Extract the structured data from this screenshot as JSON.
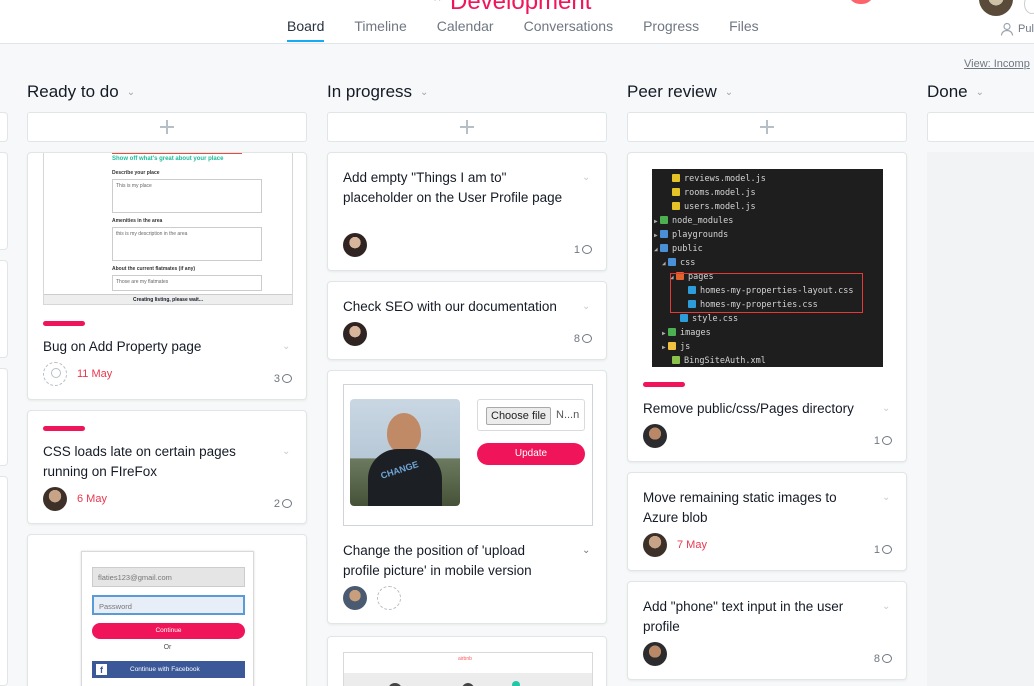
{
  "project": {
    "title": "Development"
  },
  "tabs": [
    "Board",
    "Timeline",
    "Calendar",
    "Conversations",
    "Progress",
    "Files"
  ],
  "header": {
    "public_label": "Pul",
    "view_filter": "View: Incomp"
  },
  "columns": [
    {
      "name": "Ready to do"
    },
    {
      "name": "In progress"
    },
    {
      "name": "Peer review"
    },
    {
      "name": "Done"
    }
  ],
  "cards": {
    "bug_add_property": {
      "title": "Bug on Add Property page",
      "due": "11 May",
      "comments": "3"
    },
    "css_late": {
      "title": "CSS loads late on certain pages running on FIreFox",
      "due": "6 May",
      "comments": "2"
    },
    "things_placeholder": {
      "title": "Add empty \"Things I am to\" placeholder on the User Profile page",
      "comments": "1"
    },
    "check_seo": {
      "title": "Check SEO with our documentation",
      "comments": "8"
    },
    "upload_position": {
      "title": "Change the position of 'upload profile picture' in mobile version"
    },
    "remove_css_dir": {
      "title": "Remove public/css/Pages directory",
      "comments": "1"
    },
    "static_images": {
      "title": "Move remaining static images to Azure blob",
      "due": "7 May",
      "comments": "1"
    },
    "phone_input": {
      "title": "Add \"phone\" text input in the user profile",
      "comments": "8"
    }
  },
  "screens": {
    "property_form": {
      "headline": "Show off what's great about your place",
      "describe_label": "Describe your place",
      "describe_value": "This is my place",
      "amenities_label": "Amenities in the area",
      "amenities_value": "this is my description in the area",
      "flatmates_label": "About the current flatmates (if any)",
      "flatmates_value": "Those are my flatmates",
      "status": "Creating listing, please wait..."
    },
    "file_tree": [
      {
        "name": "reviews.model.js",
        "icon": "js-icon"
      },
      {
        "name": "rooms.model.js",
        "icon": "js-icon"
      },
      {
        "name": "users.model.js",
        "icon": "js-icon"
      },
      {
        "name": "node_modules",
        "icon": "folder-icon"
      },
      {
        "name": "playgrounds",
        "icon": "folder-icon"
      },
      {
        "name": "public",
        "icon": "folder-icon"
      },
      {
        "name": "css",
        "icon": "folder-icon"
      },
      {
        "name": "pages",
        "icon": "folder-icon"
      },
      {
        "name": "homes-my-properties-layout.css",
        "icon": "css-icon"
      },
      {
        "name": "homes-my-properties.css",
        "icon": "css-icon"
      },
      {
        "name": "style.css",
        "icon": "css-icon"
      },
      {
        "name": "images",
        "icon": "folder-icon"
      },
      {
        "name": "js",
        "icon": "folder-icon"
      },
      {
        "name": "BingSiteAuth.xml",
        "icon": "xml-icon"
      }
    ],
    "upload": {
      "choose_label": "Choose file",
      "no_file": "N...n",
      "update_label": "Update",
      "shirt_logo": "CHANGE"
    },
    "login": {
      "email_value": "flaties123@gmail.com",
      "password_placeholder": "Password",
      "continue_label": "Continue",
      "or_label": "Or",
      "facebook_label": "Continue with Facebook"
    },
    "airbnb": {
      "brand": "airbnb"
    }
  },
  "colors": {
    "accent": "#f0145a",
    "tab_underline": "#14aaf5",
    "due": "#e8384f"
  }
}
